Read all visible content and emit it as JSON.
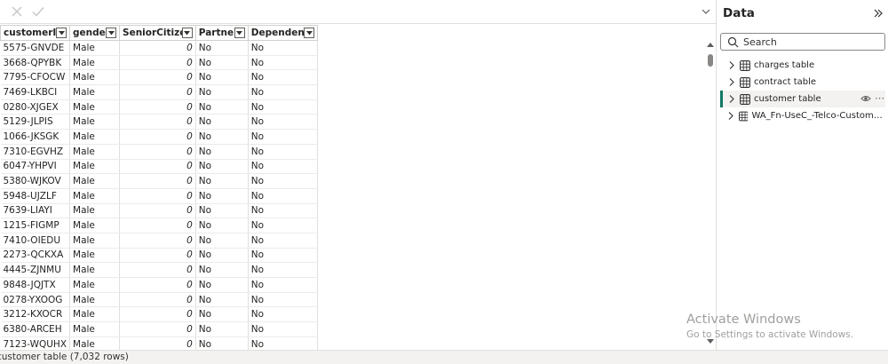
{
  "formula_bar": {
    "cancel_icon": "x-icon",
    "commit_icon": "check-icon",
    "expand_icon": "chevron-down-icon"
  },
  "grid": {
    "columns": [
      "customerID",
      "gender",
      "SeniorCitizen",
      "Partner",
      "Dependents"
    ],
    "rows": [
      [
        "5575-GNVDE",
        "Male",
        "0",
        "No",
        "No"
      ],
      [
        "3668-QPYBK",
        "Male",
        "0",
        "No",
        "No"
      ],
      [
        "7795-CFOCW",
        "Male",
        "0",
        "No",
        "No"
      ],
      [
        "7469-LKBCI",
        "Male",
        "0",
        "No",
        "No"
      ],
      [
        "0280-XJGEX",
        "Male",
        "0",
        "No",
        "No"
      ],
      [
        "5129-JLPIS",
        "Male",
        "0",
        "No",
        "No"
      ],
      [
        "1066-JKSGK",
        "Male",
        "0",
        "No",
        "No"
      ],
      [
        "7310-EGVHZ",
        "Male",
        "0",
        "No",
        "No"
      ],
      [
        "6047-YHPVI",
        "Male",
        "0",
        "No",
        "No"
      ],
      [
        "5380-WJKOV",
        "Male",
        "0",
        "No",
        "No"
      ],
      [
        "5948-UJZLF",
        "Male",
        "0",
        "No",
        "No"
      ],
      [
        "7639-LIAYI",
        "Male",
        "0",
        "No",
        "No"
      ],
      [
        "1215-FIGMP",
        "Male",
        "0",
        "No",
        "No"
      ],
      [
        "7410-OIEDU",
        "Male",
        "0",
        "No",
        "No"
      ],
      [
        "2273-QCKXA",
        "Male",
        "0",
        "No",
        "No"
      ],
      [
        "4445-ZJNMU",
        "Male",
        "0",
        "No",
        "No"
      ],
      [
        "9848-JQJTX",
        "Male",
        "0",
        "No",
        "No"
      ],
      [
        "0278-YXOOG",
        "Male",
        "0",
        "No",
        "No"
      ],
      [
        "3212-KXOCR",
        "Male",
        "0",
        "No",
        "No"
      ],
      [
        "6380-ARCEH",
        "Male",
        "0",
        "No",
        "No"
      ],
      [
        "7123-WQUHX",
        "Male",
        "0",
        "No",
        "No"
      ]
    ]
  },
  "status_bar": {
    "text": "customer table (7,032 rows)"
  },
  "data_pane": {
    "title": "Data",
    "collapse_icon": "double-chevron-right-icon",
    "search": {
      "placeholder": "Search",
      "value": ""
    },
    "tables": [
      {
        "label": "charges table",
        "selected": false
      },
      {
        "label": "contract table",
        "selected": false
      },
      {
        "label": "customer table",
        "selected": true
      },
      {
        "label": "WA_Fn-UseC_-Telco-Customer-C...",
        "selected": false
      }
    ],
    "accent_color": "#117865"
  },
  "watermark": {
    "title": "Activate Windows",
    "subtitle": "Go to Settings to activate Windows."
  }
}
